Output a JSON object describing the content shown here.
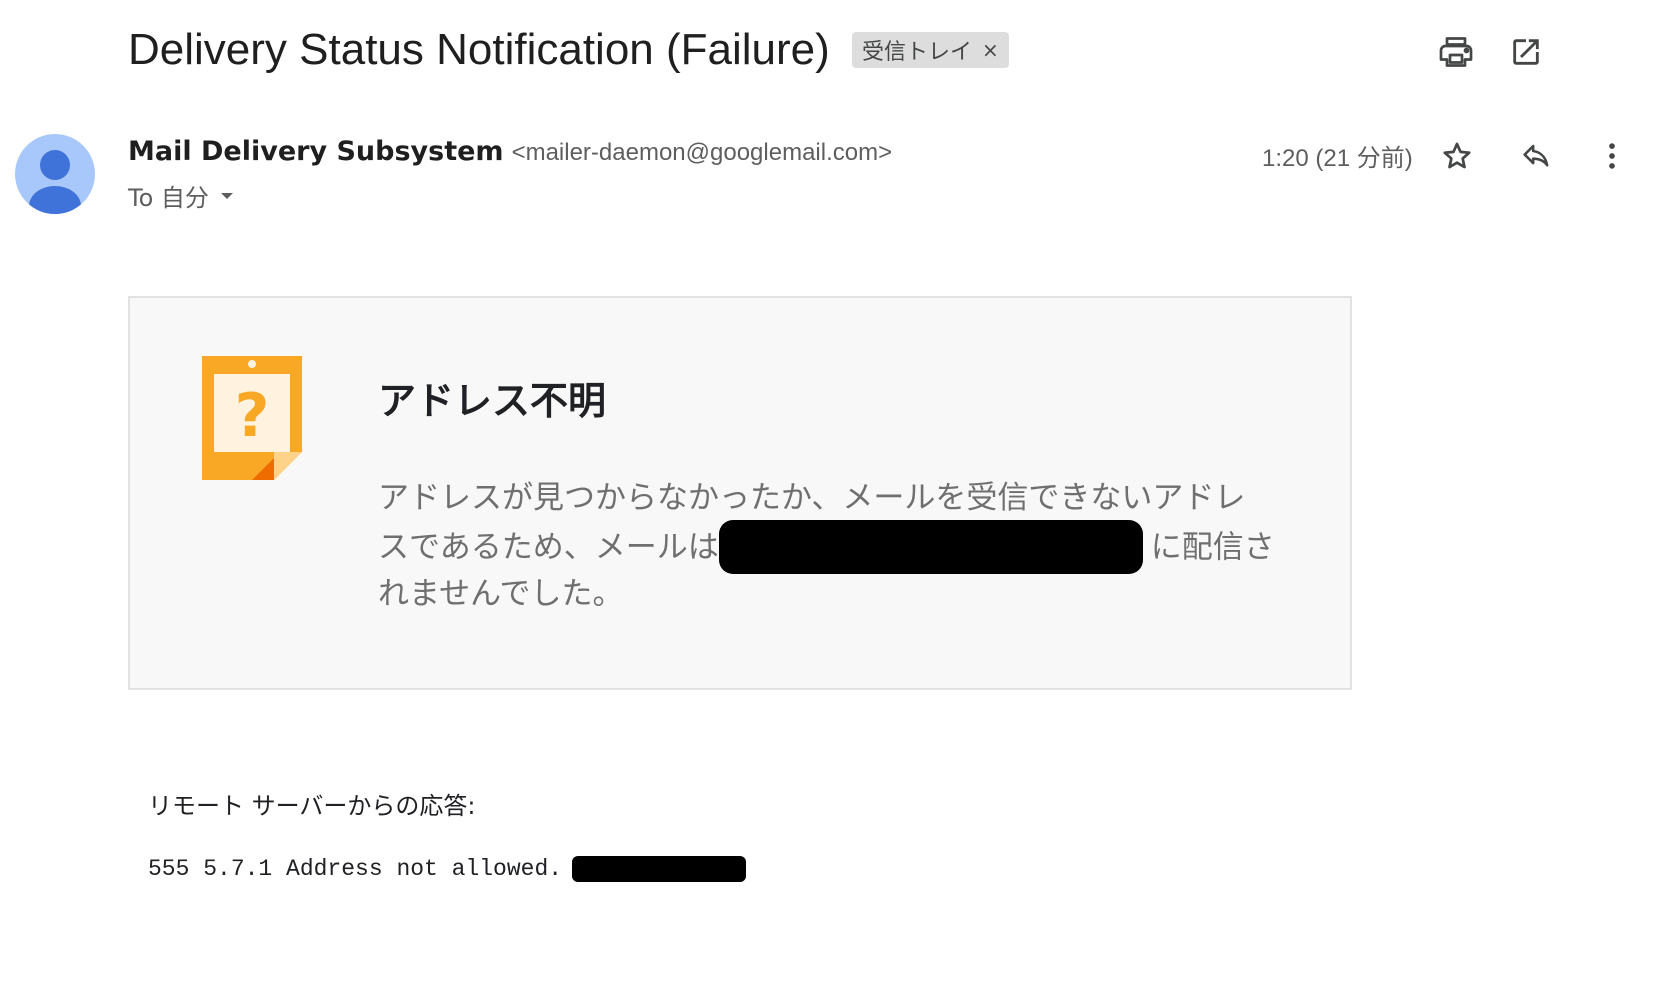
{
  "header": {
    "subject": "Delivery Status Notification (Failure)",
    "label_chip": {
      "label": "受信トレイ",
      "remove_glyph": "×"
    },
    "icons": [
      "print-icon",
      "open-in-new-window-icon"
    ]
  },
  "sender": {
    "name": "Mail Delivery Subsystem",
    "email": "<mailer-daemon@googlemail.com>",
    "to_label": "To 自分",
    "timestamp": "1:20 (21 分前)",
    "avatar_color": "#a8c7fa",
    "avatar_figure_color": "#3f73d9",
    "icons": [
      "star-icon",
      "reply-icon",
      "more-vert-icon",
      "dropdown-caret-icon"
    ]
  },
  "notice": {
    "title": "アドレス不明",
    "line1": "アドレスが見つからなかったか、メールを受信できないアドレ",
    "line2_before": "スであるため、メールは",
    "line2_after": "に配信さ",
    "line3": "れませんでした。",
    "illustration": "missing-address-note-icon",
    "accent_color": "#f9a825"
  },
  "response": {
    "label": "リモート サーバーからの応答:",
    "code_text": "555 5.7.1 Address not allowed."
  }
}
